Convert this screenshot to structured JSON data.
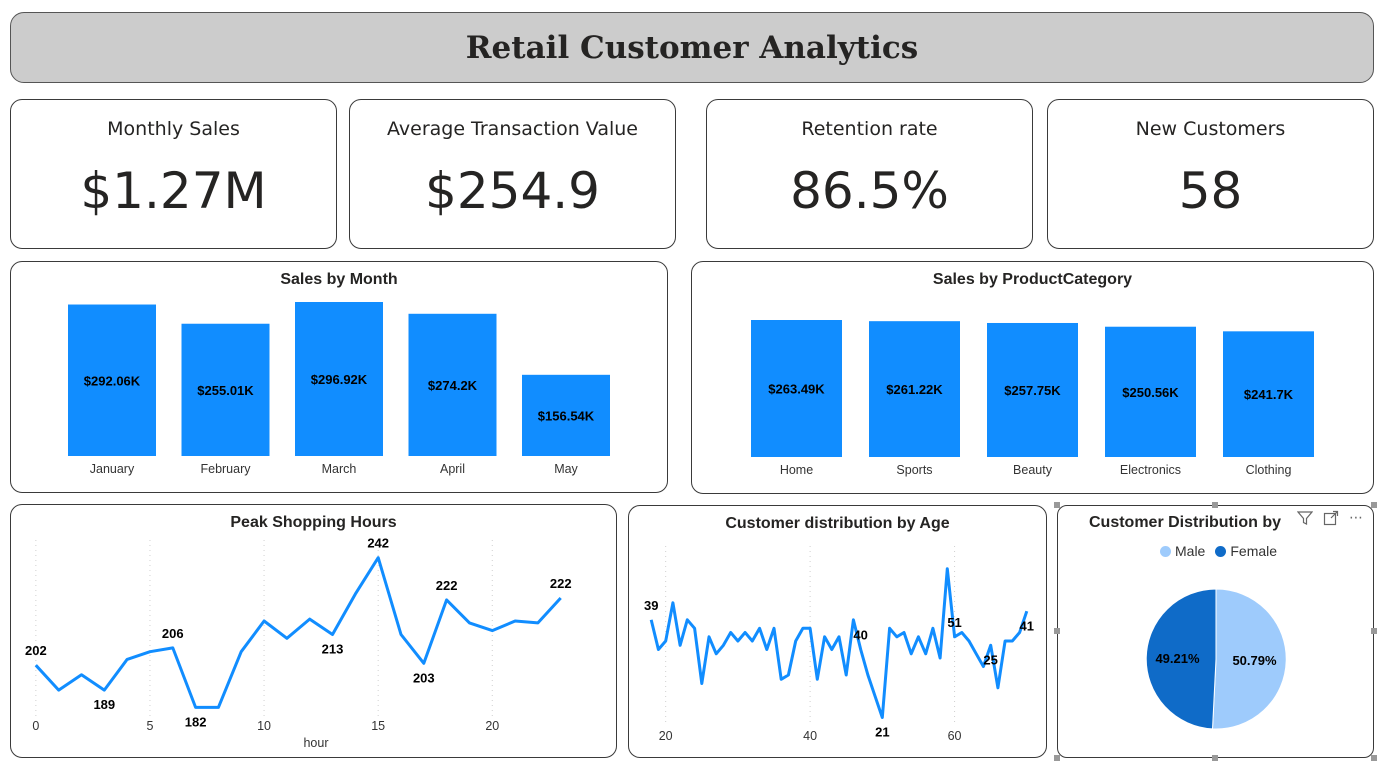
{
  "header": {
    "title": "Retail Customer Analytics"
  },
  "kpis": [
    {
      "label": "Monthly Sales",
      "value": "$1.27M"
    },
    {
      "label": "Average Transaction Value",
      "value": "$254.9"
    },
    {
      "label": "Retention rate",
      "value": "86.5%"
    },
    {
      "label": "New Customers",
      "value": "58"
    }
  ],
  "colors": {
    "bar": "#118DFF",
    "line": "#118DFF",
    "male": "#9ECBFC",
    "female": "#0F6BC8"
  },
  "chart_data": [
    {
      "type": "bar",
      "title": "Sales by Month",
      "categories": [
        "January",
        "February",
        "March",
        "April",
        "May"
      ],
      "values": [
        292.06,
        255.01,
        296.92,
        274.2,
        156.54
      ],
      "labels": [
        "$292.06K",
        "$255.01K",
        "$296.92K",
        "$274.2K",
        "$156.54K"
      ],
      "ylim": [
        0,
        296.92
      ]
    },
    {
      "type": "bar",
      "title": "Sales by ProductCategory",
      "categories": [
        "Home",
        "Sports",
        "Beauty",
        "Electronics",
        "Clothing"
      ],
      "values": [
        263.49,
        261.22,
        257.75,
        250.56,
        241.7
      ],
      "labels": [
        "$263.49K",
        "$261.22K",
        "$257.75K",
        "$250.56K",
        "$241.7K"
      ],
      "ylim": [
        0,
        263.49
      ]
    },
    {
      "type": "line",
      "title": "Peak Shopping Hours",
      "xlabel": "hour",
      "xticks": [
        0,
        5,
        10,
        15,
        20
      ],
      "x": [
        0,
        1,
        2,
        3,
        4,
        5,
        6,
        7,
        8,
        9,
        10,
        11,
        12,
        13,
        14,
        15,
        16,
        17,
        18,
        19,
        20,
        21,
        22,
        23
      ],
      "y": [
        202,
        189,
        197,
        189,
        205,
        209,
        211,
        180,
        180,
        209,
        225,
        216,
        226,
        218,
        239,
        258,
        218,
        203,
        236,
        224,
        220,
        225,
        224,
        237
      ],
      "point_labels": [
        {
          "x": 0,
          "text": "202"
        },
        {
          "x": 3,
          "text": "189"
        },
        {
          "x": 6,
          "text": "206"
        },
        {
          "x": 7,
          "text": "182"
        },
        {
          "x": 13,
          "text": "213"
        },
        {
          "x": 15,
          "text": "242"
        },
        {
          "x": 17,
          "text": "203"
        },
        {
          "x": 18,
          "text": "222"
        },
        {
          "x": 23,
          "text": "222"
        }
      ],
      "ylim": [
        175,
        262
      ],
      "xlim": [
        -0.3,
        23.8
      ]
    },
    {
      "type": "line",
      "title": "Customer distribution by Age",
      "xticks": [
        20,
        40,
        60
      ],
      "x": [
        18,
        19,
        20,
        21,
        22,
        23,
        24,
        25,
        26,
        27,
        28,
        29,
        30,
        31,
        32,
        33,
        34,
        35,
        36,
        37,
        38,
        39,
        40,
        41,
        42,
        43,
        44,
        45,
        46,
        47,
        48,
        49,
        50,
        51,
        52,
        53,
        54,
        55,
        56,
        57,
        58,
        59,
        60,
        61,
        62,
        63,
        64,
        65,
        66,
        67,
        68,
        69,
        70
      ],
      "y": [
        39,
        32,
        34,
        43,
        33,
        39,
        37,
        24,
        35,
        31,
        33,
        36,
        34,
        36,
        34,
        37,
        32,
        37,
        25,
        26,
        34,
        37,
        37,
        25,
        35,
        32,
        35,
        26,
        39,
        32,
        26,
        21,
        16,
        37,
        35,
        36,
        31,
        35,
        31,
        37,
        30,
        51,
        35,
        36,
        34,
        31,
        28,
        33,
        23,
        34,
        34,
        36,
        41
      ],
      "point_labels": [
        {
          "x": 18,
          "text": "39"
        },
        {
          "x": 47,
          "text": "40"
        },
        {
          "x": 50,
          "text": "21"
        },
        {
          "x": 60,
          "text": "51"
        },
        {
          "x": 65,
          "text": "25"
        },
        {
          "x": 70,
          "text": "41"
        }
      ],
      "ylim": [
        14,
        54
      ],
      "xlim": [
        17,
        71
      ]
    },
    {
      "type": "pie",
      "title": "Customer Distribution by",
      "legend": [
        "Male",
        "Female"
      ],
      "slices": [
        {
          "name": "Male",
          "value": 50.79,
          "label": "50.79%"
        },
        {
          "name": "Female",
          "value": 49.21,
          "label": "49.21%"
        }
      ]
    }
  ],
  "icons": {
    "filter": "filter-icon",
    "focus": "focus-mode-icon",
    "more": "more-options-icon"
  }
}
